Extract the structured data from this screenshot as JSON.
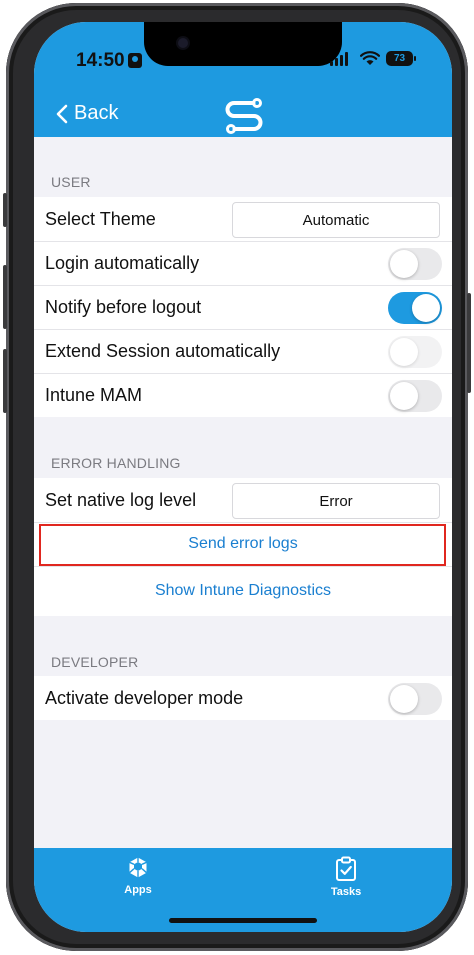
{
  "status_bar": {
    "time": "14:50",
    "battery": "73"
  },
  "nav": {
    "back_label": "Back",
    "logo_icon": "app-logo-icon"
  },
  "sections": {
    "user": {
      "title": "USER",
      "select_theme_label": "Select Theme",
      "select_theme_value": "Automatic",
      "login_auto_label": "Login automatically",
      "login_auto_on": false,
      "notify_logout_label": "Notify before logout",
      "notify_logout_on": true,
      "extend_session_label": "Extend Session automatically",
      "extend_session_on": false,
      "intune_mam_label": "Intune MAM",
      "intune_mam_on": false
    },
    "error_handling": {
      "title": "ERROR HANDLING",
      "log_level_label": "Set native log level",
      "log_level_value": "Error",
      "send_logs_label": "Send error logs",
      "show_diagnostics_label": "Show Intune Diagnostics"
    },
    "developer": {
      "title": "DEVELOPER",
      "dev_mode_label": "Activate developer mode",
      "dev_mode_on": false
    }
  },
  "tabbar": {
    "apps_label": "Apps",
    "tasks_label": "Tasks"
  },
  "colors": {
    "brand_blue": "#1e9ae0",
    "link_blue": "#1a7fd0",
    "highlight_red": "#e0271f"
  }
}
